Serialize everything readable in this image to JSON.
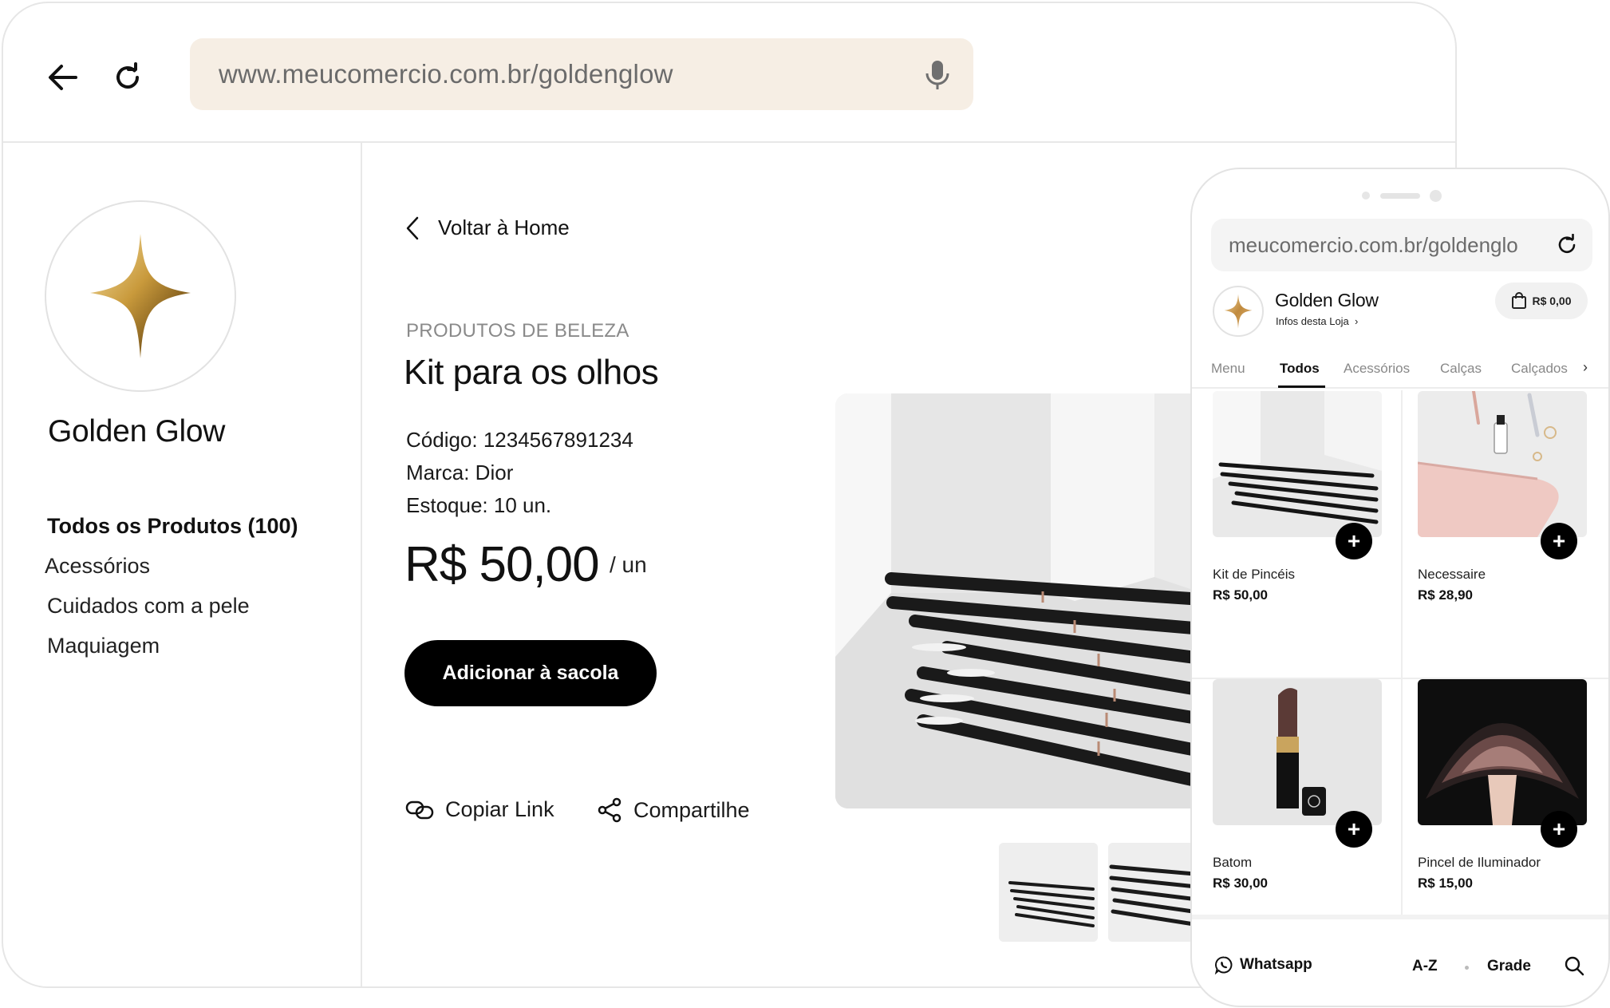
{
  "browser": {
    "url": "www.meucomercio.com.br/goldenglow"
  },
  "store": {
    "name": "Golden Glow",
    "categories": [
      "Todos os Produtos (100)",
      "Acessórios",
      "Cuidados com a pele",
      "Maquiagem"
    ]
  },
  "product": {
    "back_label": "Voltar à Home",
    "category": "PRODUTOS DE BELEZA",
    "title": "Kit para os olhos",
    "code": "Código: 1234567891234",
    "brand": "Marca: Dior",
    "stock": "Estoque: 10 un.",
    "price": "R$ 50,00",
    "unit": "/ un",
    "add_button": "Adicionar à sacola",
    "copy_link": "Copiar Link",
    "share": "Compartilhe"
  },
  "phone": {
    "url": "meucomercio.com.br/goldenglo",
    "store_name": "Golden Glow",
    "store_info": "Infos desta Loja",
    "cart_total": "R$ 0,00",
    "tabs": [
      "Menu",
      "Todos",
      "Acessórios",
      "Calças",
      "Calçados"
    ],
    "active_tab": "Todos",
    "more_tabs": "›",
    "products": [
      {
        "name": "Kit de Pincéis",
        "price": "R$ 50,00"
      },
      {
        "name": "Necessaire",
        "price": "R$ 28,90"
      },
      {
        "name": "Batom",
        "price": "R$ 30,00"
      },
      {
        "name": "Pincel de Iluminador",
        "price": "R$ 15,00"
      }
    ],
    "add_symbol": "+",
    "bottom": {
      "whatsapp": "Whatsapp",
      "sort": "A-Z",
      "view": "Grade"
    }
  },
  "icons": {
    "back": "arrow-left-icon",
    "reload": "reload-icon",
    "mic": "microphone-icon",
    "logo": "sparkle-star-icon",
    "chevron": "chevron-left-icon",
    "copy": "link-icon",
    "share": "share-icon",
    "bag": "shopping-bag-icon",
    "whatsapp": "whatsapp-icon",
    "search": "search-icon"
  },
  "colors": {
    "url_bar_bg": "#f6eee4",
    "button_bg": "#000000",
    "gold": "#c9a14a",
    "muted_text": "#8a8a8a"
  }
}
